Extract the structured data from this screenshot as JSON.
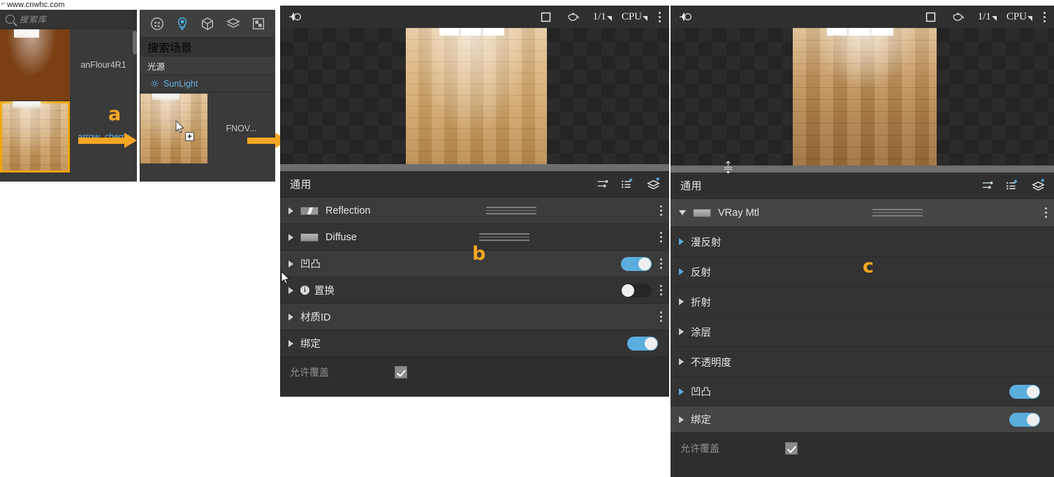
{
  "browser": {
    "url": "www.cnwhc.com",
    "favicon_glyph": "⌐"
  },
  "library_panel": {
    "search_placeholder": "搜索库",
    "items": [
      {
        "name": "anFlour4R1",
        "selected": false
      },
      {
        "name": "arrow_cherry",
        "selected": true
      }
    ]
  },
  "scene_panel": {
    "toolbar_icons": [
      "material-sphere-icon",
      "light-bulb-icon",
      "geometry-cube-icon",
      "layers-icon",
      "render-element-icon"
    ],
    "active_icon": "light-bulb-icon",
    "search_placeholder": "搜索场景",
    "category_label": "光源",
    "light_item": "SunLight",
    "dragged_asset_label": "FNOV..."
  },
  "annotations": {
    "a": "a",
    "b": "b",
    "c": "c",
    "accent_color": "#f5a623"
  },
  "mid_panel": {
    "toolbar": {
      "left_icon": "light-pair-icon",
      "square_icon": "square-icon",
      "teapot_icon": "teapot-icon",
      "ratio": "1/1",
      "device": "CPU",
      "menu_icon": "kebab-menu-icon"
    },
    "properties": {
      "header_title": "通用",
      "header_icons": [
        "sliders-icon",
        "add-list-icon",
        "add-layer-icon"
      ],
      "rows": [
        {
          "label": "Reflection",
          "swatch": "gradient",
          "lines": true,
          "toggle": null,
          "kebab": true
        },
        {
          "label": "Diffuse",
          "swatch": "flat",
          "lines": true,
          "toggle": null,
          "kebab": true
        },
        {
          "label": "凹凸",
          "swatch": null,
          "lines": false,
          "toggle": "on",
          "kebab": true
        },
        {
          "label": "置换",
          "swatch": null,
          "lines": false,
          "toggle": "off",
          "kebab": true,
          "info": true
        },
        {
          "label": "材质ID",
          "swatch": null,
          "lines": false,
          "toggle": null,
          "kebab": true
        },
        {
          "label": "绑定",
          "swatch": null,
          "lines": false,
          "toggle": "on",
          "kebab": false
        }
      ],
      "footer_label": "允许覆盖",
      "footer_checked": true
    }
  },
  "right_panel": {
    "toolbar": {
      "left_icon": "light-pair-icon",
      "square_icon": "square-icon",
      "teapot_icon": "teapot-icon",
      "ratio": "1/1",
      "device": "CPU",
      "menu_icon": "kebab-menu-icon"
    },
    "properties": {
      "header_title": "通用",
      "header_icons": [
        "sliders-icon",
        "add-list-icon",
        "add-layer-icon"
      ],
      "rows": [
        {
          "label": "VRay Mtl",
          "swatch": "flat",
          "lines": true,
          "toggle": null,
          "kebab": true,
          "expanded": true
        },
        {
          "label": "漫反射",
          "swatch": null,
          "lines": false,
          "toggle": null,
          "kebab": false
        },
        {
          "label": "反射",
          "swatch": null,
          "lines": false,
          "toggle": null,
          "kebab": false
        },
        {
          "label": "折射",
          "swatch": null,
          "lines": false,
          "toggle": null,
          "kebab": false
        },
        {
          "label": "涂层",
          "swatch": null,
          "lines": false,
          "toggle": null,
          "kebab": false
        },
        {
          "label": "不透明度",
          "swatch": null,
          "lines": false,
          "toggle": null,
          "kebab": false
        },
        {
          "label": "凹凸",
          "swatch": null,
          "lines": false,
          "toggle": "on",
          "kebab": false
        },
        {
          "label": "绑定",
          "swatch": null,
          "lines": false,
          "toggle": "on",
          "kebab": false,
          "highlight": true
        }
      ],
      "footer_label": "允许覆盖",
      "footer_checked": true
    }
  }
}
